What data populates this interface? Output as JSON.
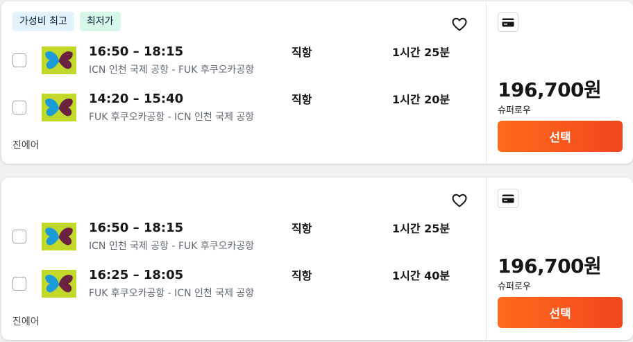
{
  "colors": {
    "accent": "#f55d1a",
    "badge_blue": "#e3f3fd",
    "badge_green": "#d7f8e9",
    "logo_bg": "#c2d82a"
  },
  "results": [
    {
      "badges": [
        "가성비 최고",
        "최저가"
      ],
      "legs": [
        {
          "time": "16:50 – 18:15",
          "route": "ICN 인천 국제 공항 - FUK 후쿠오카공항",
          "stops": "직항",
          "duration": "1시간 25분"
        },
        {
          "time": "14:20 – 15:40",
          "route": "FUK 후쿠오카공항 - ICN 인천 국제 공항",
          "stops": "직항",
          "duration": "1시간 20분"
        }
      ],
      "airline": "진에어",
      "price": "196,700원",
      "provider": "슈퍼로우",
      "select_label": "선택"
    },
    {
      "badges": [],
      "legs": [
        {
          "time": "16:50 – 18:15",
          "route": "ICN 인천 국제 공항 - FUK 후쿠오카공항",
          "stops": "직항",
          "duration": "1시간 25분"
        },
        {
          "time": "16:25 – 18:05",
          "route": "FUK 후쿠오카공항 - ICN 인천 국제 공항",
          "stops": "직항",
          "duration": "1시간 40분"
        }
      ],
      "airline": "진에어",
      "price": "196,700원",
      "provider": "슈퍼로우",
      "select_label": "선택"
    }
  ]
}
